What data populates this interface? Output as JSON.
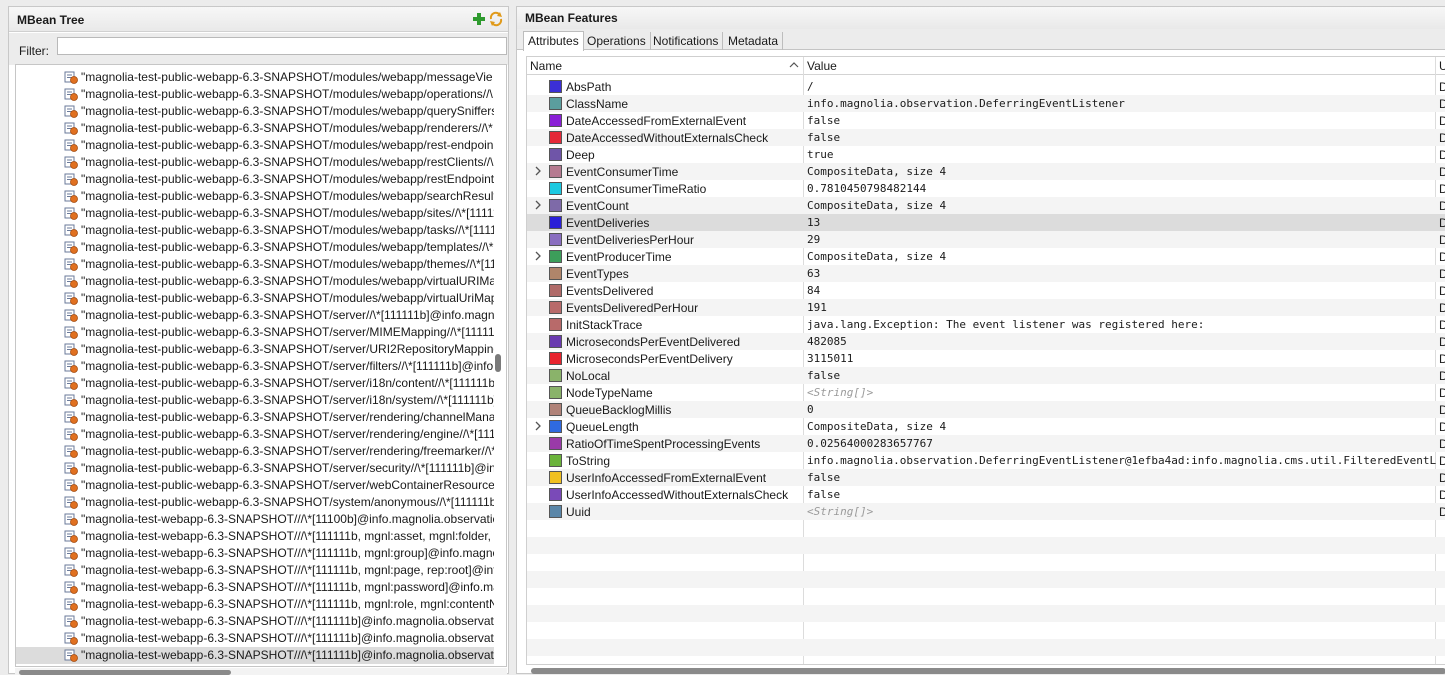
{
  "left": {
    "title": "MBean Tree",
    "filter_label": "Filter:",
    "filter_value": "",
    "tree_items": [
      {
        "label": "\"magnolia-test-public-webapp-6.3-SNAPSHOT/modules/webapp/messageVie"
      },
      {
        "label": "\"magnolia-test-public-webapp-6.3-SNAPSHOT/modules/webapp/operations//\\"
      },
      {
        "label": "\"magnolia-test-public-webapp-6.3-SNAPSHOT/modules/webapp/querySniffers"
      },
      {
        "label": "\"magnolia-test-public-webapp-6.3-SNAPSHOT/modules/webapp/renderers//\\*"
      },
      {
        "label": "\"magnolia-test-public-webapp-6.3-SNAPSHOT/modules/webapp/rest-endpoin"
      },
      {
        "label": "\"magnolia-test-public-webapp-6.3-SNAPSHOT/modules/webapp/restClients//\\"
      },
      {
        "label": "\"magnolia-test-public-webapp-6.3-SNAPSHOT/modules/webapp/restEndpoint"
      },
      {
        "label": "\"magnolia-test-public-webapp-6.3-SNAPSHOT/modules/webapp/searchResult"
      },
      {
        "label": "\"magnolia-test-public-webapp-6.3-SNAPSHOT/modules/webapp/sites//\\*[11111"
      },
      {
        "label": "\"magnolia-test-public-webapp-6.3-SNAPSHOT/modules/webapp/tasks//\\*[1111"
      },
      {
        "label": "\"magnolia-test-public-webapp-6.3-SNAPSHOT/modules/webapp/templates//\\*"
      },
      {
        "label": "\"magnolia-test-public-webapp-6.3-SNAPSHOT/modules/webapp/themes//\\*[11"
      },
      {
        "label": "\"magnolia-test-public-webapp-6.3-SNAPSHOT/modules/webapp/virtualURIMa"
      },
      {
        "label": "\"magnolia-test-public-webapp-6.3-SNAPSHOT/modules/webapp/virtualUriMap"
      },
      {
        "label": "\"magnolia-test-public-webapp-6.3-SNAPSHOT/server//\\*[111111b]@info.magno"
      },
      {
        "label": "\"magnolia-test-public-webapp-6.3-SNAPSHOT/server/MIMEMapping//\\*[11111"
      },
      {
        "label": "\"magnolia-test-public-webapp-6.3-SNAPSHOT/server/URI2RepositoryMapping"
      },
      {
        "label": "\"magnolia-test-public-webapp-6.3-SNAPSHOT/server/filters//\\*[111111b]@info."
      },
      {
        "label": "\"magnolia-test-public-webapp-6.3-SNAPSHOT/server/i18n/content//\\*[111111b"
      },
      {
        "label": "\"magnolia-test-public-webapp-6.3-SNAPSHOT/server/i18n/system//\\*[111111b]"
      },
      {
        "label": "\"magnolia-test-public-webapp-6.3-SNAPSHOT/server/rendering/channelMana"
      },
      {
        "label": "\"magnolia-test-public-webapp-6.3-SNAPSHOT/server/rendering/engine//\\*[111"
      },
      {
        "label": "\"magnolia-test-public-webapp-6.3-SNAPSHOT/server/rendering/freemarker//\\*"
      },
      {
        "label": "\"magnolia-test-public-webapp-6.3-SNAPSHOT/server/security//\\*[111111b]@inf"
      },
      {
        "label": "\"magnolia-test-public-webapp-6.3-SNAPSHOT/server/webContainerResources"
      },
      {
        "label": "\"magnolia-test-public-webapp-6.3-SNAPSHOT/system/anonymous//\\*[111111b,"
      },
      {
        "label": "\"magnolia-test-webapp-6.3-SNAPSHOT///\\*[11100b]@info.magnolia.observatic"
      },
      {
        "label": "\"magnolia-test-webapp-6.3-SNAPSHOT///\\*[111111b, mgnl:asset, mgnl:folder, n"
      },
      {
        "label": "\"magnolia-test-webapp-6.3-SNAPSHOT///\\*[111111b, mgnl:group]@info.magno"
      },
      {
        "label": "\"magnolia-test-webapp-6.3-SNAPSHOT///\\*[111111b, mgnl:page, rep:root]@info"
      },
      {
        "label": "\"magnolia-test-webapp-6.3-SNAPSHOT///\\*[111111b, mgnl:password]@info.ma"
      },
      {
        "label": "\"magnolia-test-webapp-6.3-SNAPSHOT///\\*[111111b, mgnl:role, mgnl:contentN"
      },
      {
        "label": "\"magnolia-test-webapp-6.3-SNAPSHOT///\\*[111111b]@info.magnolia.observatic"
      },
      {
        "label": "\"magnolia-test-webapp-6.3-SNAPSHOT///\\*[111111b]@info.magnolia.observatic"
      },
      {
        "label": "\"magnolia-test-webapp-6.3-SNAPSHOT///\\*[111111b]@info.magnolia.observatic",
        "selected": true
      },
      {
        "label": "\"magnolia-test-webapp-6.3-SNAPSHOT///\\*[111111b]@info.magnolia.observatic"
      }
    ]
  },
  "right": {
    "title": "MBean Features",
    "tabs": [
      "Attributes",
      "Operations",
      "Notifications",
      "Metadata"
    ],
    "active_tab": "Attributes",
    "columns": {
      "name": "Name",
      "value": "Value",
      "u": "U"
    },
    "rows": [
      {
        "name": "AbsPath",
        "value": "/",
        "color": "#3b2fd6",
        "expandable": false
      },
      {
        "name": "ClassName",
        "value": "info.magnolia.observation.DeferringEventListener",
        "color": "#5b9e9e",
        "expandable": false
      },
      {
        "name": "DateAccessedFromExternalEvent",
        "value": "false",
        "color": "#8a1fd6",
        "expandable": false
      },
      {
        "name": "DateAccessedWithoutExternalsCheck",
        "value": "false",
        "color": "#e52838",
        "expandable": false
      },
      {
        "name": "Deep",
        "value": "true",
        "color": "#6f55a8",
        "expandable": false
      },
      {
        "name": "EventConsumerTime",
        "value": "CompositeData, size 4",
        "color": "#b57a90",
        "expandable": true
      },
      {
        "name": "EventConsumerTimeRatio",
        "value": "0.7810450798482144",
        "color": "#1cc9e0",
        "expandable": false
      },
      {
        "name": "EventCount",
        "value": "CompositeData, size 4",
        "color": "#7e6aa8",
        "expandable": true
      },
      {
        "name": "EventDeliveries",
        "value": "13",
        "color": "#2a1fd8",
        "expandable": false,
        "selected": true
      },
      {
        "name": "EventDeliveriesPerHour",
        "value": "29",
        "color": "#8a6ec0",
        "expandable": false
      },
      {
        "name": "EventProducerTime",
        "value": "CompositeData, size 4",
        "color": "#3c9e5a",
        "expandable": true
      },
      {
        "name": "EventTypes",
        "value": "63",
        "color": "#b0856a",
        "expandable": false
      },
      {
        "name": "EventsDelivered",
        "value": "84",
        "color": "#b06a68",
        "expandable": false
      },
      {
        "name": "EventsDeliveredPerHour",
        "value": "191",
        "color": "#b86a6a",
        "expandable": false
      },
      {
        "name": "InitStackTrace",
        "value": "java.lang.Exception: The event listener was registered here:",
        "color": "#b86a6a",
        "expandable": false
      },
      {
        "name": "MicrosecondsPerEventDelivered",
        "value": "482085",
        "color": "#6a3ab0",
        "expandable": false
      },
      {
        "name": "MicrosecondsPerEventDelivery",
        "value": "3115011",
        "color": "#e8232e",
        "expandable": false
      },
      {
        "name": "NoLocal",
        "value": "false",
        "color": "#8ab36a",
        "expandable": false
      },
      {
        "name": "NodeTypeName",
        "value": "<String[]>",
        "color": "#8ab36a",
        "expandable": false,
        "placeholder": true
      },
      {
        "name": "QueueBacklogMillis",
        "value": "0",
        "color": "#b08278",
        "expandable": false
      },
      {
        "name": "QueueLength",
        "value": "CompositeData, size 4",
        "color": "#2f6ae0",
        "expandable": true
      },
      {
        "name": "RatioOfTimeSpentProcessingEvents",
        "value": "0.02564000283657767",
        "color": "#9a3aa8",
        "expandable": false
      },
      {
        "name": "ToString",
        "value": "info.magnolia.observation.DeferringEventListener@1efba4ad:info.magnolia.cms.util.FilteredEventL",
        "color": "#6ab33a",
        "expandable": false
      },
      {
        "name": "UserInfoAccessedFromExternalEvent",
        "value": "false",
        "color": "#f0c020",
        "expandable": false
      },
      {
        "name": "UserInfoAccessedWithoutExternalsCheck",
        "value": "false",
        "color": "#7a4ab8",
        "expandable": false
      },
      {
        "name": "Uuid",
        "value": "<String[]>",
        "color": "#5a86a8",
        "expandable": false,
        "placeholder": true
      }
    ],
    "u_value": "D"
  }
}
